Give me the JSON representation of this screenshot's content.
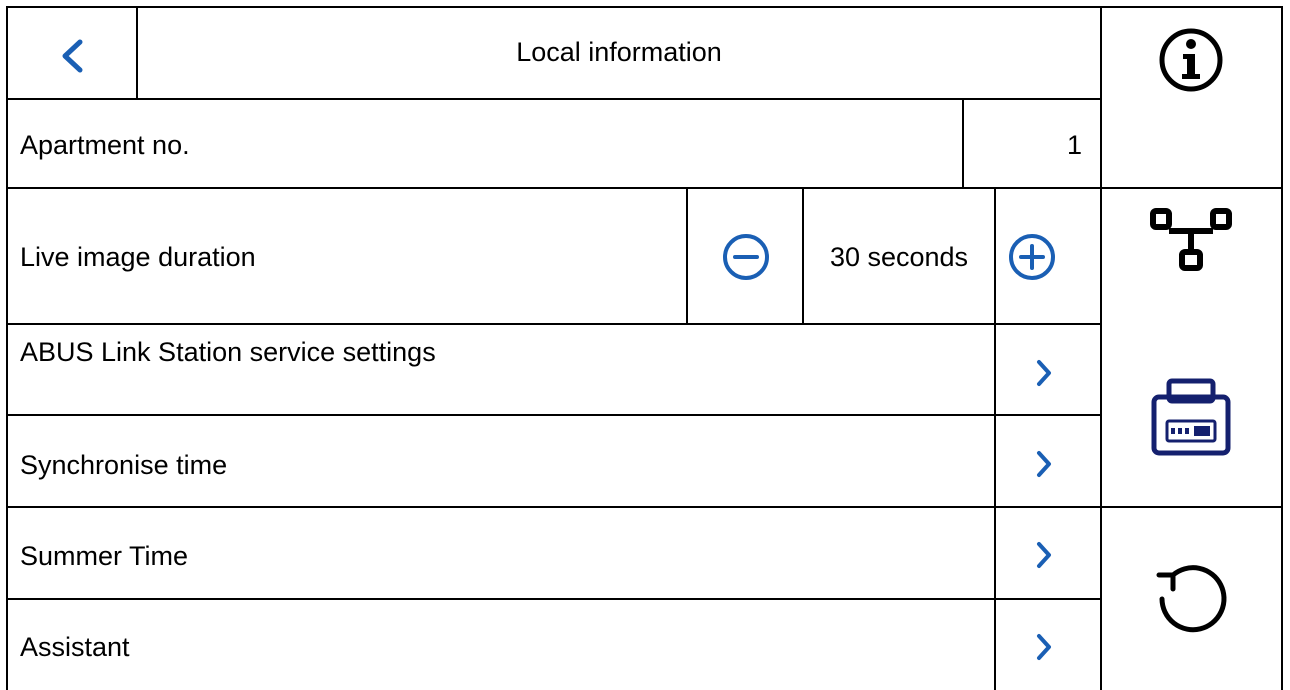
{
  "header": {
    "title": "Local information",
    "back_icon": "chevron-left-icon"
  },
  "rows": {
    "apartment": {
      "label": "Apartment no.",
      "value": "1"
    },
    "live_image": {
      "label": "Live image duration",
      "value": "30 seconds",
      "minus_icon": "minus-circle-icon",
      "plus_icon": "plus-circle-icon"
    },
    "link_station": {
      "label": "ABUS Link Station service settings"
    },
    "sync_time": {
      "label": "Synchronise time"
    },
    "summer_time": {
      "label": "Summer Time"
    },
    "assistant": {
      "label": "Assistant"
    }
  },
  "sidebar": {
    "items": [
      {
        "icon": "info-icon"
      },
      {
        "icon": "network-icon"
      },
      {
        "icon": "device-icon"
      },
      {
        "icon": "reset-icon"
      }
    ]
  },
  "colors": {
    "accent": "#1a5fb4",
    "dark_blue": "#14206e",
    "line": "#000000"
  }
}
